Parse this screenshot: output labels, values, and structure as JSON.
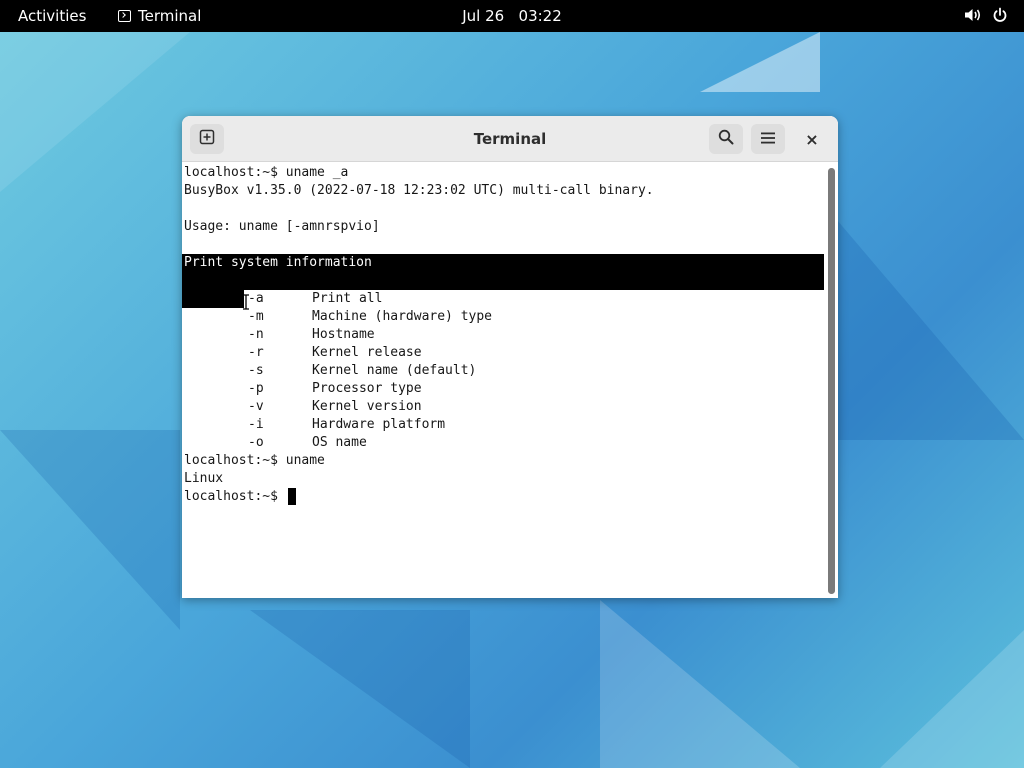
{
  "topbar": {
    "activities": "Activities",
    "app_name": "Terminal",
    "clock_date": "Jul 26",
    "clock_time": "03:22"
  },
  "window": {
    "title": "Terminal",
    "close_label": "×"
  },
  "terminal": {
    "lines": [
      "localhost:~$ uname _a",
      "BusyBox v1.35.0 (2022-07-18 12:23:02 UTC) multi-call binary.",
      "",
      "Usage: uname [-amnrspvio]",
      "",
      "Print system information",
      ""
    ],
    "options": [
      {
        "flag": "-a",
        "desc": "Print all"
      },
      {
        "flag": "-m",
        "desc": "Machine (hardware) type"
      },
      {
        "flag": "-n",
        "desc": "Hostname"
      },
      {
        "flag": "-r",
        "desc": "Kernel release"
      },
      {
        "flag": "-s",
        "desc": "Kernel name (default)"
      },
      {
        "flag": "-p",
        "desc": "Processor type"
      },
      {
        "flag": "-v",
        "desc": "Kernel version"
      },
      {
        "flag": "-i",
        "desc": "Hardware platform"
      },
      {
        "flag": "-o",
        "desc": "OS name"
      }
    ],
    "after": [
      "localhost:~$ uname",
      "Linux",
      "localhost:~$ "
    ]
  },
  "icons": {
    "new_tab": "new-tab-icon",
    "search": "search-icon",
    "menu": "hamburger-menu-icon",
    "close": "close-icon",
    "volume": "volume-icon",
    "power": "power-icon"
  }
}
